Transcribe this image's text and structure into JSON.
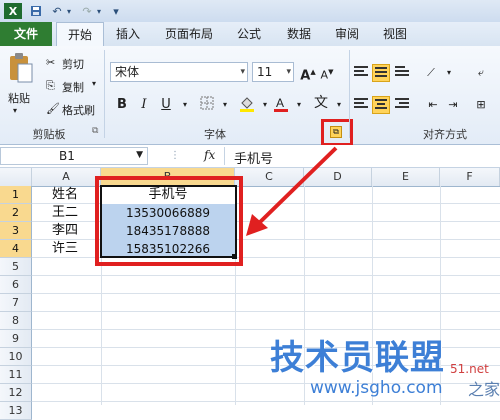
{
  "tabs": [
    "文件",
    "开始",
    "插入",
    "页面布局",
    "公式",
    "数据",
    "审阅",
    "视图"
  ],
  "clipboard": {
    "paste": "粘贴",
    "cut": "剪切",
    "copy": "复制",
    "format_painter": "格式刷",
    "group_label": "剪贴板"
  },
  "font": {
    "name": "宋体",
    "size": "11",
    "group_label": "字体",
    "bold": "B",
    "italic": "I",
    "underline": "U",
    "grow": "A",
    "shrink": "A"
  },
  "alignment": {
    "group_label": "对齐方式"
  },
  "formula_bar": {
    "name_box": "B1",
    "fx": "fx",
    "content": "手机号"
  },
  "columns": [
    "A",
    "B",
    "C",
    "D",
    "E",
    "F"
  ],
  "rows": [
    "1",
    "2",
    "3",
    "4",
    "5",
    "6",
    "7",
    "8",
    "9",
    "10",
    "11",
    "12",
    "13"
  ],
  "cells": {
    "A1": "姓名",
    "A2": "王二",
    "A3": "李四",
    "A4": "许三",
    "B1": "手机号",
    "B2": "13530066889",
    "B3": "18435178888",
    "B4": "15835102266"
  },
  "watermark": {
    "title": "技术员联盟",
    "url": "www.jsgho.com",
    "side": "51.net",
    "side2": "之家"
  },
  "colors": {
    "highlight_red": "#e02020",
    "file_tab": "#2f7d32",
    "selection": "#bcd3ee"
  }
}
